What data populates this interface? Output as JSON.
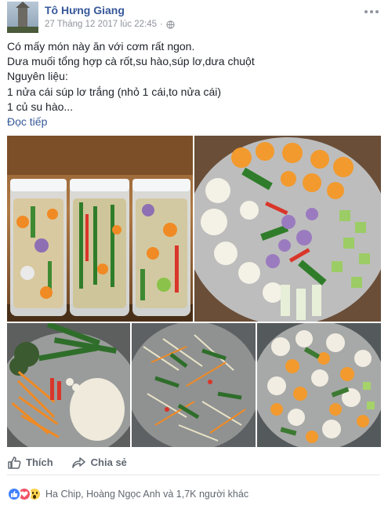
{
  "post": {
    "author": "Tô Hưng Giang",
    "timestamp": "27 Tháng 12 2017 lúc 22:45",
    "privacy_icon": "globe-icon",
    "lines": [
      "Có mấy món này ăn với cơm rất ngon.",
      "Dưa muối tổng hợp cà rốt,su hào,súp lơ,dưa chuột",
      "Nguyên liệu:",
      "1 nửa cái súp lơ trắng (nhỏ 1 cái,to nửa cái)",
      "1 củ su hào..."
    ],
    "see_more": "Đọc tiếp"
  },
  "actions": {
    "like_label": "Thích",
    "share_label": "Chia sẻ"
  },
  "reactions": {
    "icons": [
      "like-reaction-icon",
      "love-reaction-icon",
      "wow-reaction-icon"
    ],
    "summary": "Ha Chip, Hoàng Ngọc Anh và 1,7K người khác"
  },
  "colors": {
    "link": "#365899",
    "meta": "#90949c",
    "like_blue": "#4080ff",
    "love_red": "#f25268",
    "wow_yellow": "#fcd24f"
  }
}
